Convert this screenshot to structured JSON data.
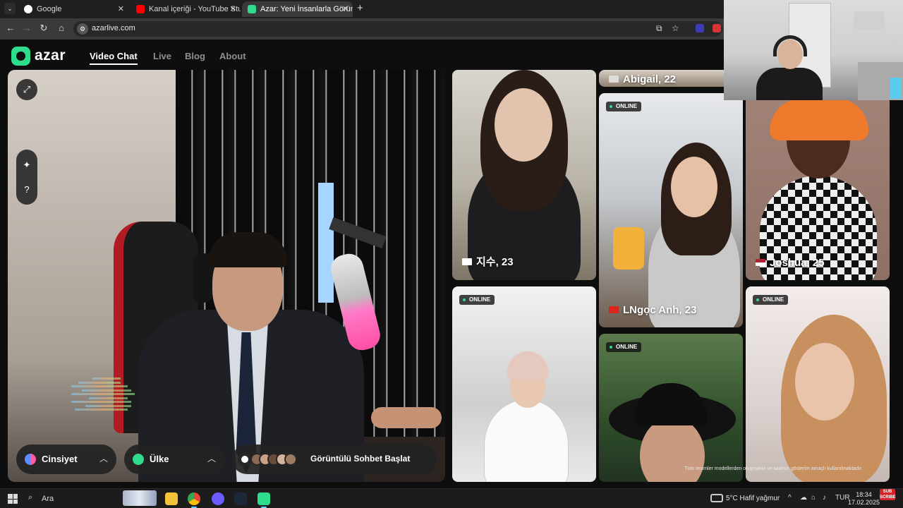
{
  "browser": {
    "tabs": [
      {
        "title": "Google",
        "close": "✕",
        "color": "#ffffff"
      },
      {
        "title": "Kanal içeriği - YouTube Studio",
        "close": "✕",
        "color": "#ff0000"
      },
      {
        "title": "Azar: Yeni İnsanlarla Görün",
        "close": "✕",
        "color": "#2fdc8c"
      }
    ],
    "new_tab": "+",
    "url": "azarlive.com"
  },
  "site": {
    "logo": "azar",
    "nav": [
      "Video Chat",
      "Live",
      "Blog",
      "About"
    ],
    "controls": {
      "gender": "Cinsiyet",
      "country": "Ülke",
      "start": "Görüntülü Sohbet Başlat"
    },
    "profiles": [
      {
        "name": "Abigail, 22",
        "online": false
      },
      {
        "name": "지수, 23",
        "online": false
      },
      {
        "name": "LNgọc Anh, 23",
        "online": true
      },
      {
        "name": "Joshua, 25",
        "online": false
      },
      {
        "name": "",
        "online": true
      },
      {
        "name": "",
        "online": true
      },
      {
        "name": "",
        "online": true
      }
    ],
    "online_label": "ONLINE",
    "disclaimer": "Tüm resimler modellerden oluşmakta ve sadece gösterim amaçlı kullanılmaktadır."
  },
  "taskbar": {
    "search": "Ara",
    "weather": "5°C  Hafif yağmur",
    "language": "TUR",
    "time": "18:34",
    "date": "17.02.2025",
    "sub": "SUB SCRIBE"
  },
  "colors": {
    "accent": "#2fdc8c",
    "online_dot": "#2fdc8c",
    "youtube_red": "#ff0000"
  }
}
